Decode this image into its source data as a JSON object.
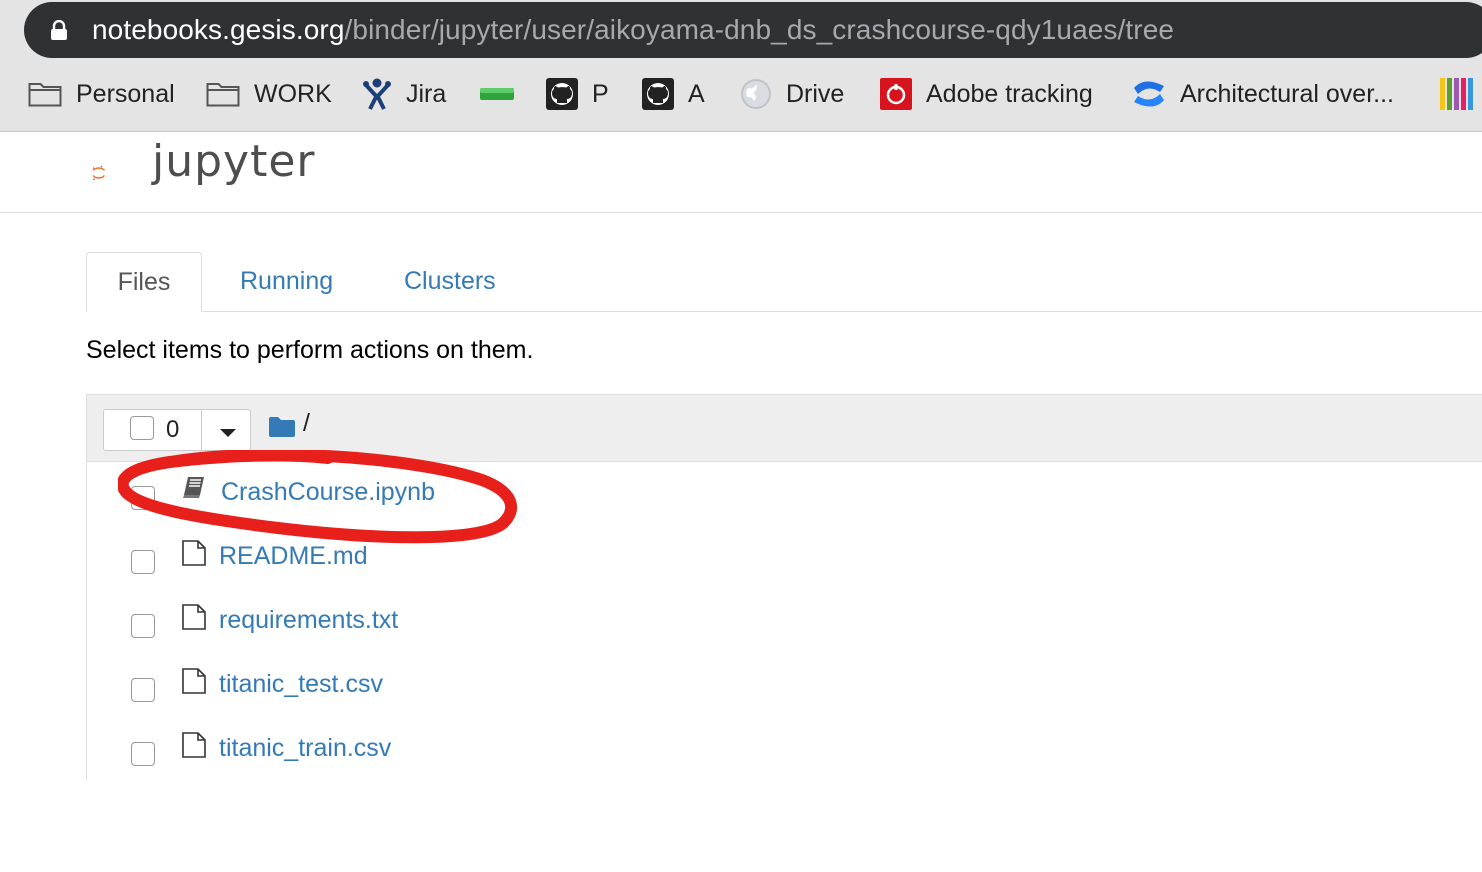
{
  "browser": {
    "url_host": "notebooks.gesis.org",
    "url_path": "/binder/jupyter/user/aikoyama-dnb_ds_crashcourse-qdy1uaes/tree",
    "bookmarks": [
      {
        "label": "Personal",
        "icon": "folder-icon"
      },
      {
        "label": "WORK",
        "icon": "folder-icon"
      },
      {
        "label": "Jira",
        "icon": "jira-icon"
      },
      {
        "label": "",
        "icon": "battery-icon"
      },
      {
        "label": "P",
        "icon": "github-icon"
      },
      {
        "label": "A",
        "icon": "github-icon"
      },
      {
        "label": "Drive",
        "icon": "globe-icon"
      },
      {
        "label": "Adobe tracking",
        "icon": "adobe-icon"
      },
      {
        "label": "Architectural over...",
        "icon": "confluence-icon"
      },
      {
        "label": "",
        "icon": "colorbar-icon"
      }
    ]
  },
  "app": {
    "logo_text": "jupyter"
  },
  "tabs": [
    {
      "label": "Files",
      "active": true
    },
    {
      "label": "Running",
      "active": false
    },
    {
      "label": "Clusters",
      "active": false
    }
  ],
  "hint": "Select items to perform actions on them.",
  "list": {
    "selected_count": "0",
    "breadcrumb": "/",
    "files": [
      {
        "name": "CrashCourse.ipynb",
        "type": "notebook",
        "icon": "notebook-icon",
        "highlighted": true
      },
      {
        "name": "README.md",
        "type": "file",
        "icon": "file-icon"
      },
      {
        "name": "requirements.txt",
        "type": "file",
        "icon": "file-icon"
      },
      {
        "name": "titanic_test.csv",
        "type": "file",
        "icon": "file-icon"
      },
      {
        "name": "titanic_train.csv",
        "type": "file",
        "icon": "file-icon"
      }
    ]
  },
  "colors": {
    "link": "#337ab7",
    "annotation": "#e8201c",
    "jupyter_orange": "#f37726",
    "url_bar": "#2f3133"
  }
}
